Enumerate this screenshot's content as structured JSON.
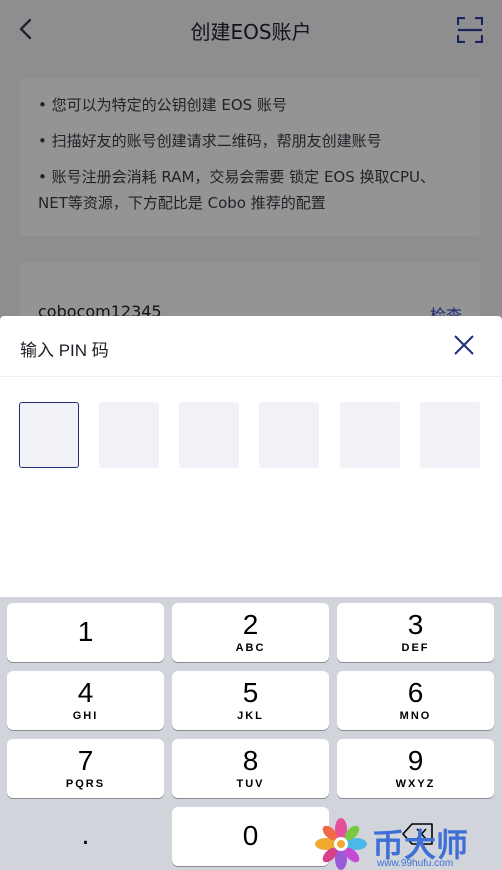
{
  "nav": {
    "title": "创建EOS账户",
    "back_icon": "chevron-left-icon",
    "scan_icon": "scan-icon"
  },
  "info": {
    "lines": [
      "• 您可以为特定的公钥创建 EOS 账号",
      "• 扫描好友的账号创建请求二维码，帮朋友创建账号",
      "• 账号注册会消耗 RAM，交易会需要 锁定 EOS 换取CPU、NET等资源，下方配比是 Cobo 推荐的配置"
    ]
  },
  "account": {
    "name": "cobocom12345",
    "check_label": "检查"
  },
  "pin_sheet": {
    "title": "输入 PIN 码",
    "close_icon": "close-icon",
    "digits_entered": 0,
    "length": 6
  },
  "keyboard": {
    "keys": [
      {
        "digit": "1",
        "letters": ""
      },
      {
        "digit": "2",
        "letters": "ABC"
      },
      {
        "digit": "3",
        "letters": "DEF"
      },
      {
        "digit": "4",
        "letters": "GHI"
      },
      {
        "digit": "5",
        "letters": "JKL"
      },
      {
        "digit": "6",
        "letters": "MNO"
      },
      {
        "digit": "7",
        "letters": "PQRS"
      },
      {
        "digit": "8",
        "letters": "TUV"
      },
      {
        "digit": "9",
        "letters": "WXYZ"
      }
    ],
    "dot": ".",
    "zero": "0",
    "delete_icon": "backspace-icon"
  },
  "watermark": {
    "name": "币大师",
    "url": "www.99hufu.com"
  },
  "colors": {
    "accent": "#1f2f77",
    "link": "#2b4ecb",
    "keyboard_bg": "#d1d4db",
    "pin_box": "#f1f2f7"
  }
}
